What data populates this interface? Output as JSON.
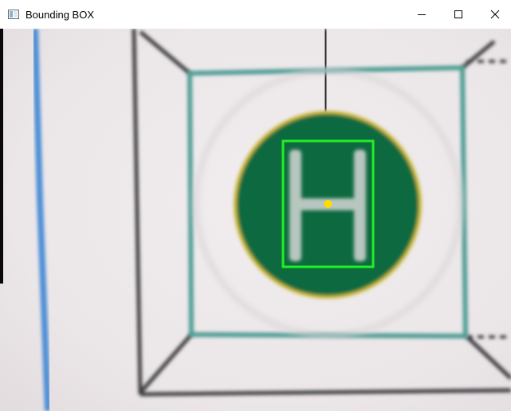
{
  "window": {
    "title": "Bounding BOX",
    "controls": {
      "minimize_icon": "minimize-icon",
      "maximize_icon": "maximize-icon",
      "close_icon": "close-icon"
    }
  },
  "camera_frame": {
    "scene": "helipad-marker",
    "marker_letter": "H",
    "colors": {
      "background": "#ece7e9",
      "marker_fill": "#0c6b3f",
      "marker_rim": "#c9b83a",
      "marker_letter": "#b7c6bf",
      "frame_lines": "#3d3c40",
      "teal_lines": "#4e9c92",
      "blue_line": "#4d8fd6",
      "bbox": "#22ee22",
      "center_point": "#ffdd00"
    }
  },
  "detection": {
    "label": "bounding-box",
    "bbox_color": "#22ee22",
    "center_marker_color": "#ffdd00"
  }
}
